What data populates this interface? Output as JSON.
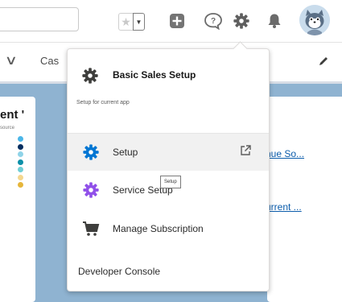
{
  "header": {
    "search_value": "",
    "favorite_star": "★",
    "favorite_dropdown": "▼"
  },
  "nav": {
    "tab_label": "Cas",
    "chevron": "∨"
  },
  "left_card": {
    "title": "ent '",
    "subtitle": "source",
    "legend": [
      {
        "label": "",
        "color": "#4bb6e8"
      },
      {
        "label": "",
        "color": "#032d60"
      },
      {
        "label": "",
        "color": "#8fd3e8"
      },
      {
        "label": "",
        "color": "#0b8fa8"
      },
      {
        "label": "",
        "color": "#6fcfd6"
      },
      {
        "label": "",
        "color": "#f4d78f"
      },
      {
        "label": "",
        "color": "#e6b63b"
      }
    ]
  },
  "right_card": {
    "link_top": "nue So...",
    "link_bottom": "urrent ..."
  },
  "menu": {
    "title": "Basic Sales Setup",
    "subtitle": "Setup for current app",
    "items": [
      {
        "label": "Setup",
        "icon": "gear-icon",
        "color": "#0176d3"
      },
      {
        "label": "Service Setup",
        "icon": "gear-icon",
        "color": "#9050e9"
      },
      {
        "label": "Manage Subscription",
        "icon": "cart-icon",
        "color": "#3e3e3c"
      }
    ],
    "developer_console": "Developer Console"
  },
  "tooltip": {
    "text": "Setup"
  },
  "colors": {
    "brand_blue": "#0176d3",
    "purple": "#9050e9",
    "background_blue": "#8fb3d1"
  }
}
